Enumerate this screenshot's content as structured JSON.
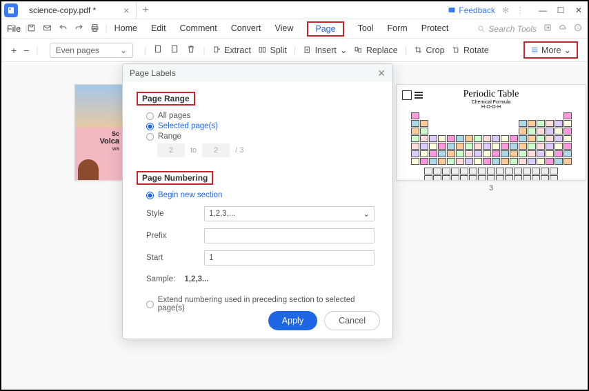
{
  "titlebar": {
    "tab_name": "science-copy.pdf *",
    "feedback": "Feedback"
  },
  "menubar": {
    "file": "File",
    "items": [
      "Home",
      "Edit",
      "Comment",
      "Convert",
      "View",
      "Page",
      "Tool",
      "Form",
      "Protect"
    ],
    "active_index": 5,
    "search_placeholder": "Search Tools"
  },
  "toolbar": {
    "page_filter": "Even pages",
    "extract": "Extract",
    "split": "Split",
    "insert": "Insert",
    "replace": "Replace",
    "crop": "Crop",
    "rotate": "Rotate",
    "more": "More"
  },
  "thumbs": {
    "left": {
      "line1": "Sc",
      "line2": "Volca",
      "line3": "wa"
    },
    "right": {
      "title": "Periodic Table",
      "sub1": "Chemical Formula",
      "sub2": "H-O-O-H",
      "page_num": "3"
    }
  },
  "dialog": {
    "title": "Page Labels",
    "page_range": {
      "heading": "Page Range",
      "all": "All pages",
      "selected": "Selected page(s)",
      "range": "Range",
      "from": "2",
      "to_label": "to",
      "to": "2",
      "total": "/ 3"
    },
    "page_numbering": {
      "heading": "Page Numbering",
      "begin": "Begin new section",
      "style_label": "Style",
      "style_value": "1,2,3,...",
      "prefix_label": "Prefix",
      "prefix_value": "",
      "start_label": "Start",
      "start_value": "1",
      "sample_label": "Sample:",
      "sample_value": "1,2,3...",
      "extend": "Extend numbering used in preceding section to selected page(s)"
    },
    "buttons": {
      "apply": "Apply",
      "cancel": "Cancel"
    }
  }
}
